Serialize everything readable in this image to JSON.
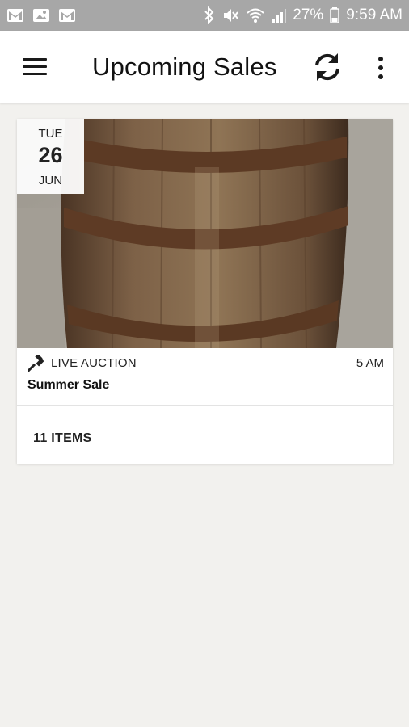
{
  "status_bar": {
    "battery_percent": "27%",
    "time": "9:59 AM",
    "left_icons": [
      "gmail-icon",
      "image-icon",
      "gmail-icon"
    ],
    "right_icons": [
      "bluetooth-icon",
      "mute-icon",
      "wifi-icon",
      "signal-icon",
      "battery-icon"
    ]
  },
  "app_bar": {
    "title": "Upcoming Sales",
    "menu_icon": "hamburger-menu-icon",
    "refresh_icon": "refresh-icon",
    "more_icon": "more-vert-icon"
  },
  "sale": {
    "date": {
      "day_of_week": "TUE",
      "day": "26",
      "month": "JUN"
    },
    "type": "LIVE AUCTION",
    "type_icon": "gavel-icon",
    "time": "5 AM",
    "name": "Summer Sale",
    "items_count": "11 ITEMS",
    "image": "wooden-barrel-photo"
  },
  "colors": {
    "status_bar": "#a7a7a7",
    "app_bar": "#ffffff",
    "background": "#f2f1ee",
    "text": "#111111"
  }
}
